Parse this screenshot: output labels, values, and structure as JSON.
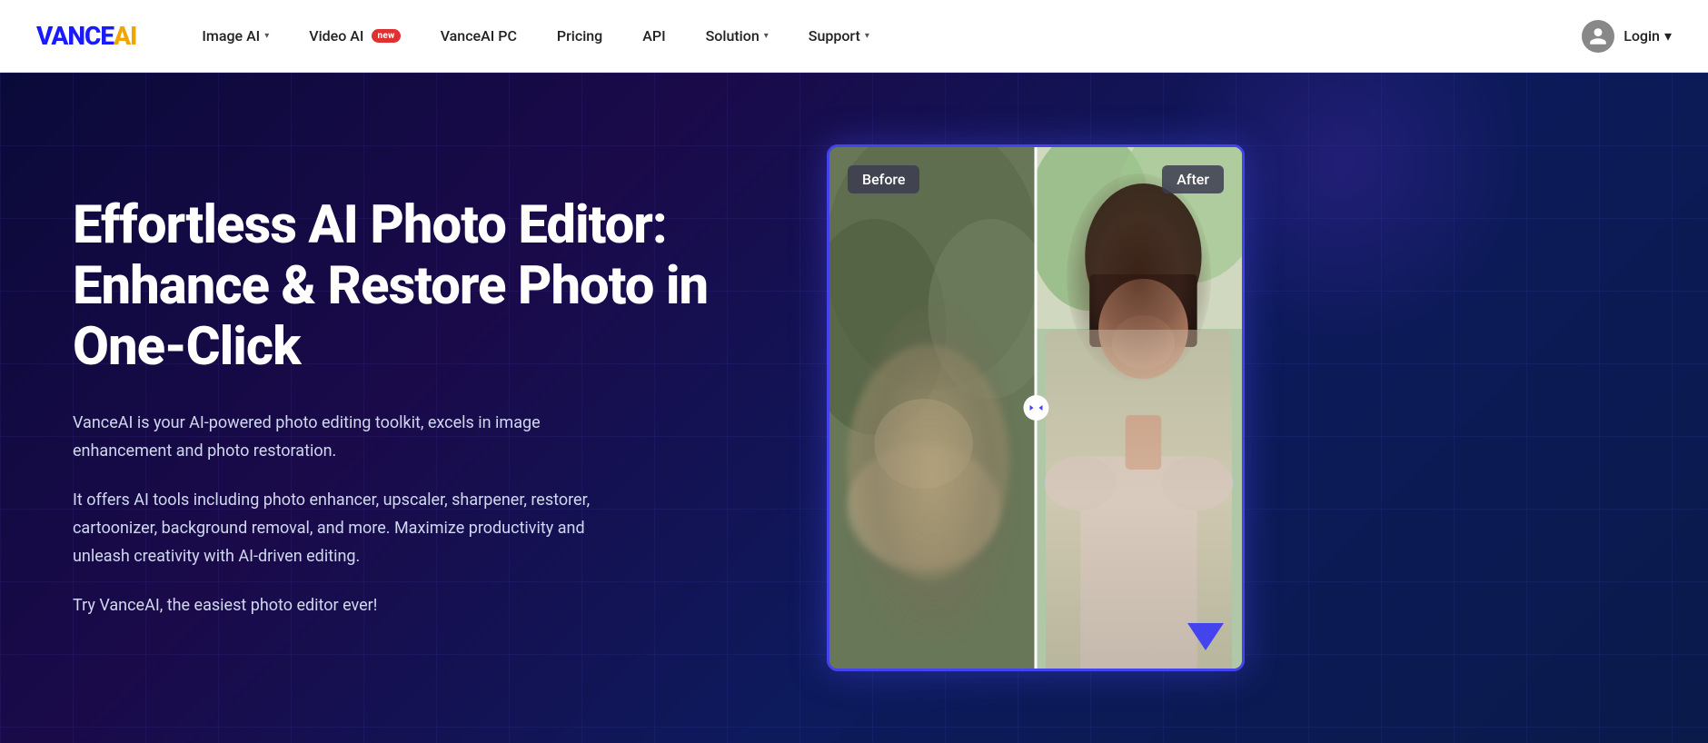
{
  "brand": {
    "logo_vance": "VANCE",
    "logo_ai": "AI"
  },
  "nav": {
    "items": [
      {
        "id": "image-ai",
        "label": "Image AI",
        "has_dropdown": true,
        "badge": null
      },
      {
        "id": "video-ai",
        "label": "Video AI",
        "has_dropdown": false,
        "badge": "new"
      },
      {
        "id": "vanceai-pc",
        "label": "VanceAI PC",
        "has_dropdown": false,
        "badge": null
      },
      {
        "id": "pricing",
        "label": "Pricing",
        "has_dropdown": false,
        "badge": null
      },
      {
        "id": "api",
        "label": "API",
        "has_dropdown": false,
        "badge": null
      },
      {
        "id": "solution",
        "label": "Solution",
        "has_dropdown": true,
        "badge": null
      },
      {
        "id": "support",
        "label": "Support",
        "has_dropdown": true,
        "badge": null
      }
    ],
    "login_label": "Login"
  },
  "hero": {
    "title": "Effortless AI Photo Editor: Enhance & Restore Photo in One-Click",
    "description1": "VanceAI is your AI-powered photo editing toolkit, excels in image enhancement and photo restoration.",
    "description2": "It offers AI tools including photo enhancer, upscaler, sharpener, restorer, cartoonizer, background removal, and more. Maximize productivity and unleash creativity with AI-driven editing.",
    "tagline": "Try VanceAI, the easiest photo editor ever!",
    "before_label": "Before",
    "after_label": "After"
  },
  "colors": {
    "logo_blue": "#1a1aff",
    "logo_yellow": "#f0a500",
    "nav_bg": "#ffffff",
    "hero_bg_start": "#0a0a3a",
    "hero_bg_end": "#0d1a5c",
    "card_border": "#4444ee",
    "badge_bg": "#e03030"
  }
}
